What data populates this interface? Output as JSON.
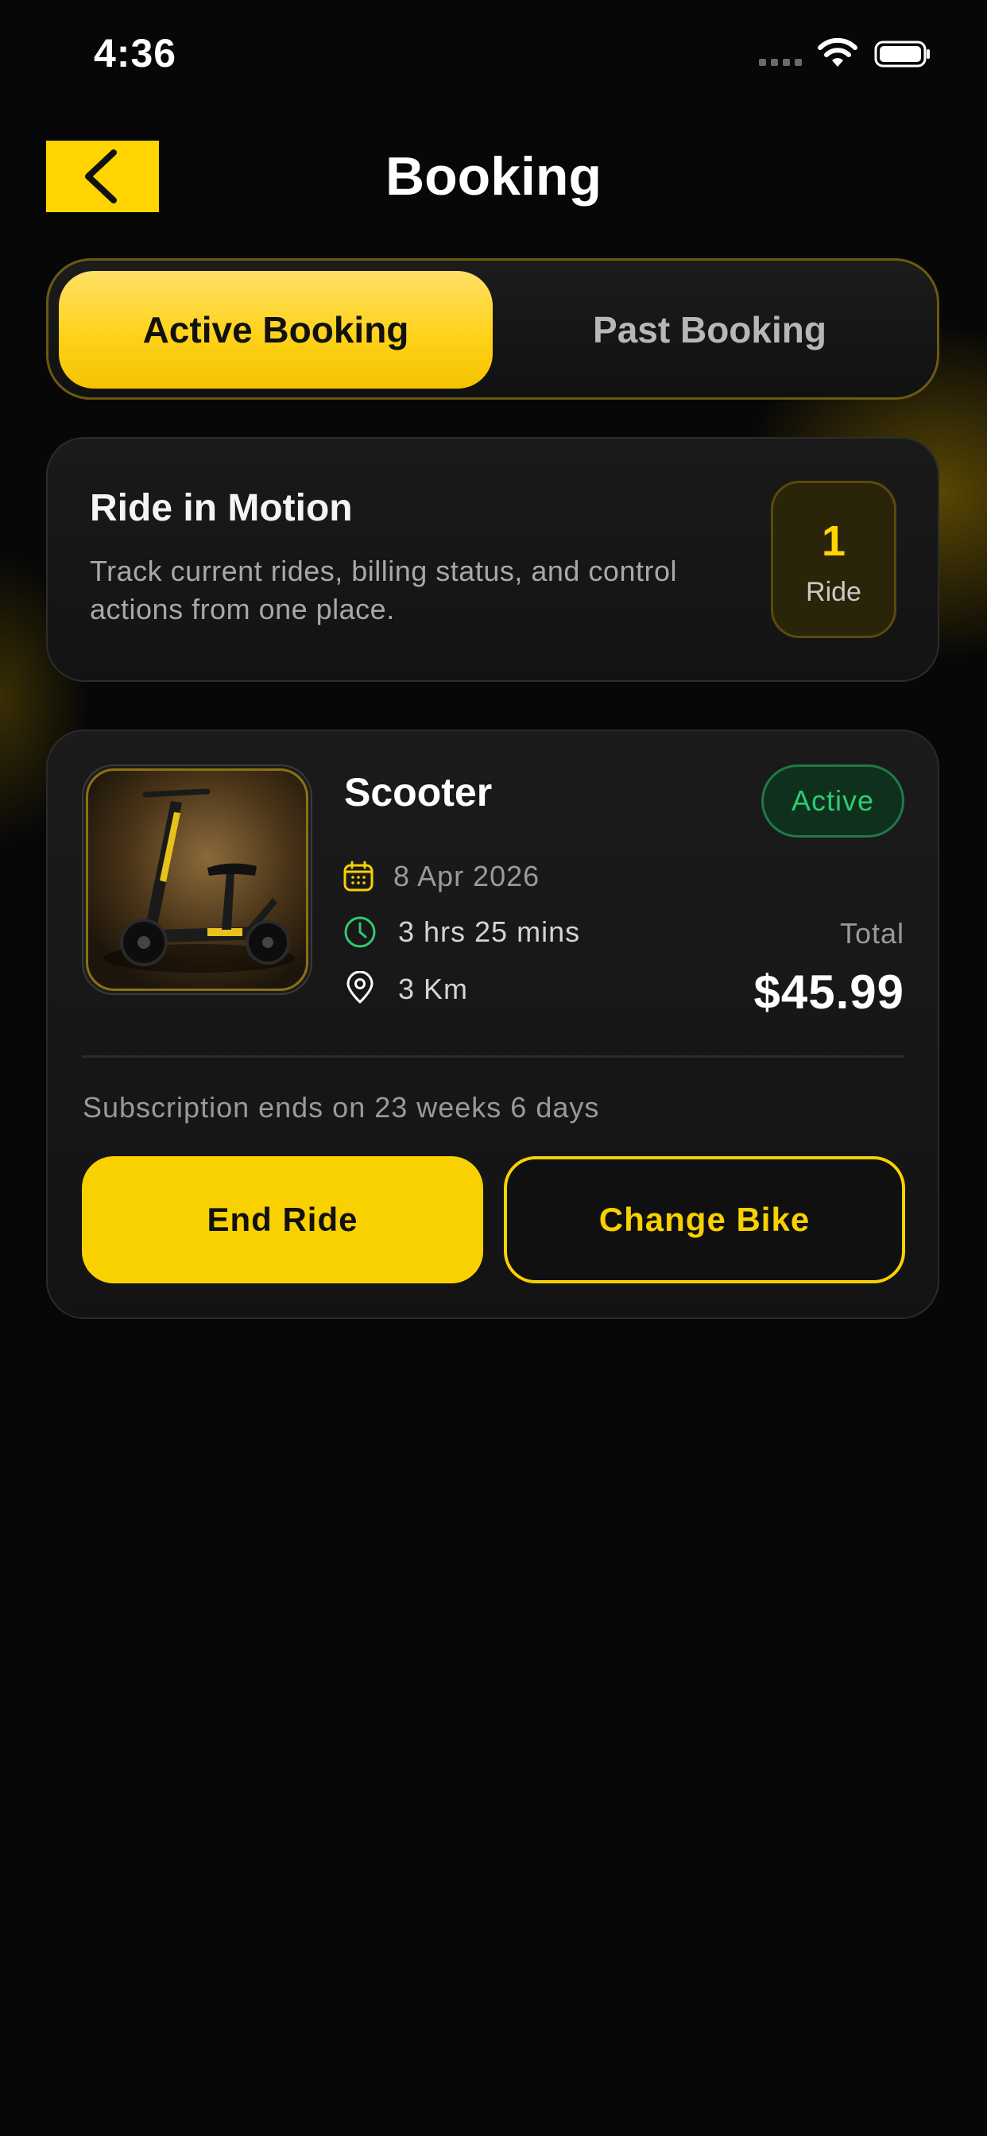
{
  "status_bar": {
    "time": "4:36"
  },
  "header": {
    "title": "Booking"
  },
  "tabs": [
    {
      "label": "Active Booking",
      "active": true
    },
    {
      "label": "Past Booking",
      "active": false
    }
  ],
  "summary": {
    "title": "Ride in Motion",
    "description": "Track current rides, billing status, and control actions from one place.",
    "count": "1",
    "count_label": "Ride"
  },
  "booking": {
    "vehicle": "Scooter",
    "status": "Active",
    "date": "8 Apr 2026",
    "duration": "3 hrs 25 mins",
    "distance": "3 Km",
    "total_label": "Total",
    "total_value": "$45.99",
    "subscription": "Subscription ends on 23 weeks 6 days",
    "end_label": "End Ride",
    "change_label": "Change Bike"
  },
  "colors": {
    "accent": "#FAD100",
    "background": "#070707",
    "status_active": "#2ECC71"
  }
}
